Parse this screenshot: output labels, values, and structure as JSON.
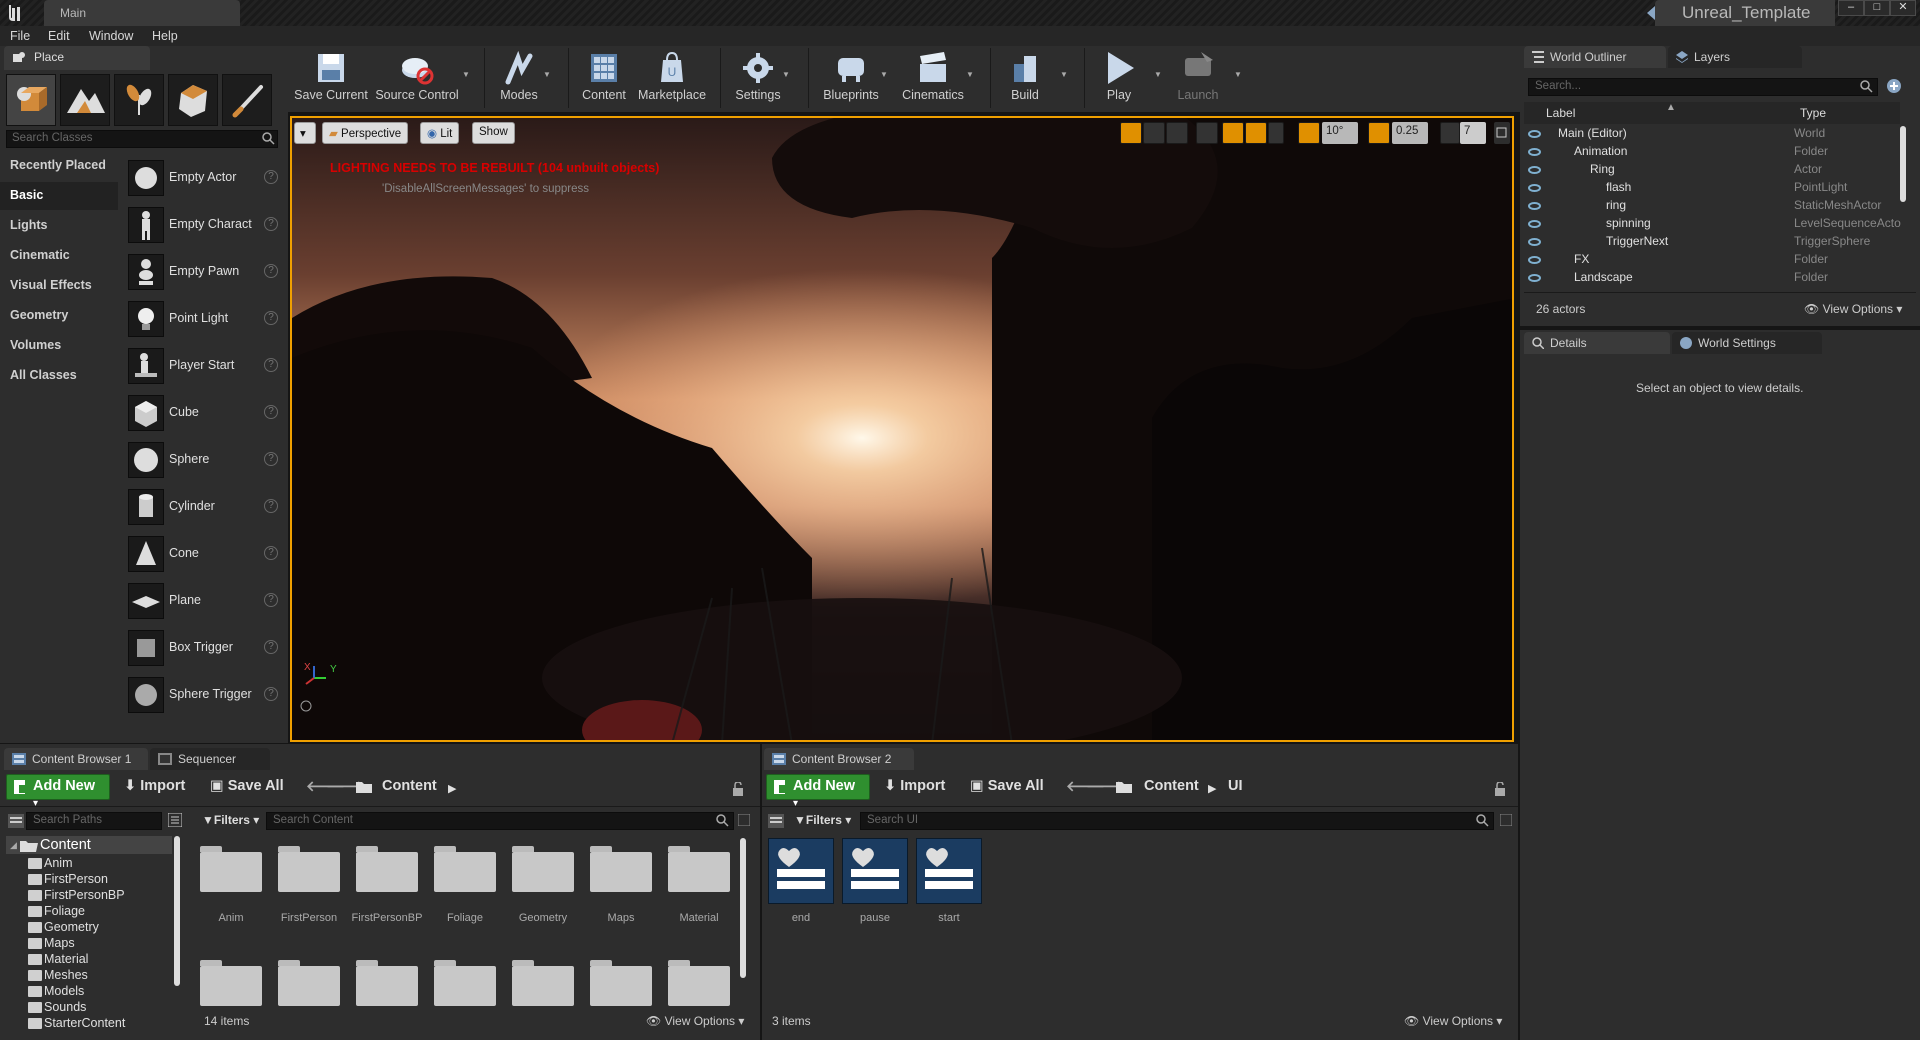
{
  "window": {
    "tab_title": "Main",
    "project_name": "Unreal_Template",
    "controls": [
      "–",
      "□",
      "✕"
    ]
  },
  "menu": [
    "File",
    "Edit",
    "Window",
    "Help"
  ],
  "place_panel": {
    "tab_label": "Place",
    "search_placeholder": "Search Classes",
    "categories": [
      "Recently Placed",
      "Basic",
      "Lights",
      "Cinematic",
      "Visual Effects",
      "Geometry",
      "Volumes",
      "All Classes"
    ],
    "active_category": "Basic",
    "classes": [
      "Empty Actor",
      "Empty Charact",
      "Empty Pawn",
      "Point Light",
      "Player Start",
      "Cube",
      "Sphere",
      "Cylinder",
      "Cone",
      "Plane",
      "Box Trigger",
      "Sphere Trigger"
    ]
  },
  "toolbar": {
    "buttons": [
      {
        "label": "Save Current",
        "icon": "save-icon"
      },
      {
        "label": "Source Control",
        "icon": "source-control-icon"
      },
      {
        "label": "Modes",
        "icon": "modes-icon"
      },
      {
        "label": "Content",
        "icon": "content-icon"
      },
      {
        "label": "Marketplace",
        "icon": "marketplace-icon"
      },
      {
        "label": "Settings",
        "icon": "settings-icon"
      },
      {
        "label": "Blueprints",
        "icon": "blueprints-icon"
      },
      {
        "label": "Cinematics",
        "icon": "cinematics-icon"
      },
      {
        "label": "Build",
        "icon": "build-icon"
      },
      {
        "label": "Play",
        "icon": "play-icon"
      },
      {
        "label": "Launch",
        "icon": "launch-icon"
      }
    ]
  },
  "viewport": {
    "perspective_label": "Perspective",
    "lit_label": "Lit",
    "show_label": "Show",
    "warning": "LIGHTING NEEDS TO BE REBUILT (104 unbuilt objects)",
    "warning_sub": "'DisableAllScreenMessages' to suppress",
    "rotation_snap": "10°",
    "scale_snap": "0.25",
    "camera_speed": "7",
    "axis_x": "X",
    "axis_y": "Y"
  },
  "content_browser_1": {
    "tab_label": "Content Browser 1",
    "sequencer_tab": "Sequencer",
    "add_new": "Add New",
    "import": "Import",
    "save_all": "Save All",
    "path": [
      "Content"
    ],
    "search_paths_placeholder": "Search Paths",
    "filters": "Filters",
    "search_placeholder": "Search Content",
    "tree_root": "Content",
    "tree": [
      "Anim",
      "FirstPerson",
      "FirstPersonBP",
      "Foliage",
      "Geometry",
      "Maps",
      "Material",
      "Meshes",
      "Models",
      "Sounds",
      "StarterContent"
    ],
    "folders": [
      "Anim",
      "FirstPerson",
      "FirstPersonBP",
      "Foliage",
      "Geometry",
      "Maps",
      "Material"
    ],
    "item_count": "14 items",
    "view_options": "View Options"
  },
  "content_browser_2": {
    "tab_label": "Content Browser 2",
    "add_new": "Add New",
    "import": "Import",
    "save_all": "Save All",
    "path": [
      "Content",
      "UI"
    ],
    "filters": "Filters",
    "search_placeholder": "Search UI",
    "assets": [
      "end",
      "pause",
      "start"
    ],
    "item_count": "3 items",
    "view_options": "View Options"
  },
  "world_outliner": {
    "tab_label": "World Outliner",
    "layers_tab": "Layers",
    "search_placeholder": "Search...",
    "col_label": "Label",
    "col_type": "Type",
    "rows": [
      {
        "label": "Main (Editor)",
        "type": "World",
        "indent": 0
      },
      {
        "label": "Animation",
        "type": "Folder",
        "indent": 1
      },
      {
        "label": "Ring",
        "type": "Actor",
        "indent": 2
      },
      {
        "label": "flash",
        "type": "PointLight",
        "indent": 3
      },
      {
        "label": "ring",
        "type": "StaticMeshActor",
        "indent": 3
      },
      {
        "label": "spinning",
        "type": "LevelSequenceActo",
        "indent": 3
      },
      {
        "label": "TriggerNext",
        "type": "TriggerSphere",
        "indent": 3
      },
      {
        "label": "FX",
        "type": "Folder",
        "indent": 1
      },
      {
        "label": "Landscape",
        "type": "Folder",
        "indent": 1
      }
    ],
    "actor_count": "26 actors",
    "view_options": "View Options"
  },
  "details": {
    "tab_label": "Details",
    "world_settings_tab": "World Settings",
    "empty_message": "Select an object to view details."
  },
  "colors": {
    "accent_orange": "#f0a000",
    "add_new_green": "#2f8f2f",
    "warning_red": "#d80000",
    "panel_bg": "#2d2d2d"
  }
}
